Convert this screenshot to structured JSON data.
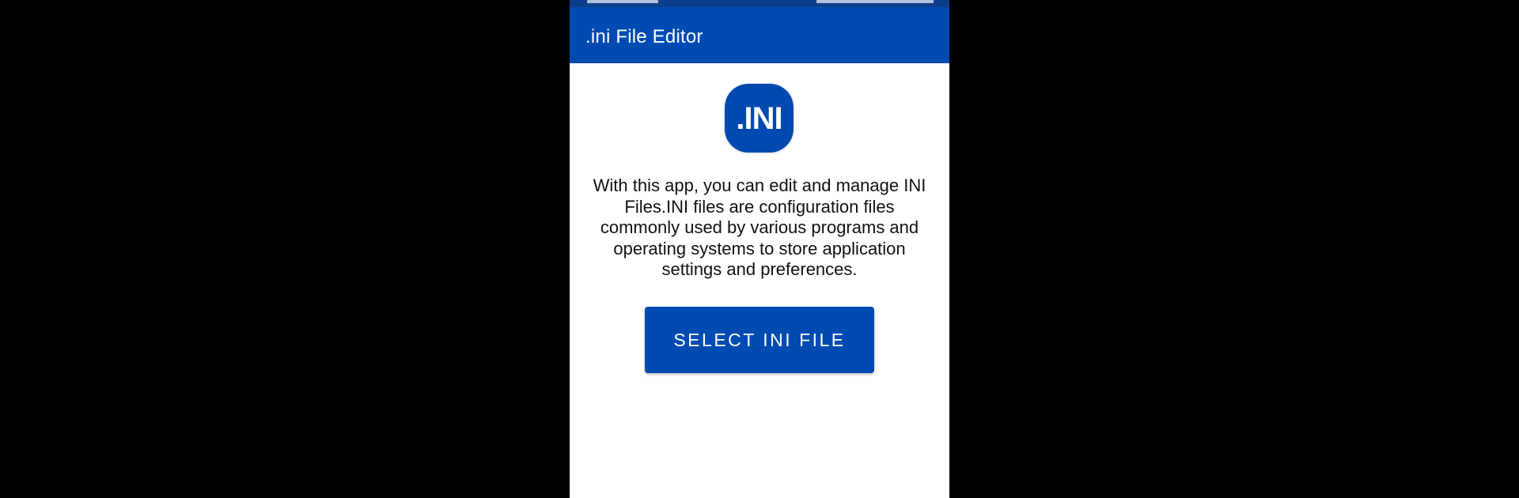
{
  "app_bar": {
    "title": ".ini File Editor"
  },
  "logo": {
    "text": ".INI"
  },
  "main": {
    "description": "With this app, you can edit and manage INI Files.INI files are configuration files commonly used by various programs and operating systems to store application settings and preferences.",
    "select_button_label": "SELECT INI FILE"
  },
  "colors": {
    "primary": "#004bb2",
    "status_bar": "#0d3e8c",
    "background": "#ffffff",
    "outer_background": "#000000",
    "text": "#111111",
    "on_primary": "#ffffff"
  }
}
